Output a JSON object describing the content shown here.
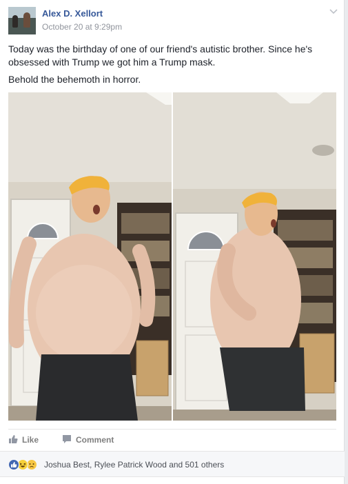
{
  "post": {
    "author": "Alex D. Xellort",
    "timestamp": "October 20 at 9:29pm",
    "text_line1": "Today was the birthday of one of our friend's autistic brother. Since he's obsessed with Trump we got him a Trump mask.",
    "text_line2": "Behold the behemoth in horror.",
    "photos": [
      {
        "name": "photo-left"
      },
      {
        "name": "photo-right"
      }
    ]
  },
  "actions": {
    "like_label": "Like",
    "comment_label": "Comment"
  },
  "reactions": {
    "icons": [
      "like-reaction-icon",
      "haha-reaction-icon",
      "sad-reaction-icon"
    ],
    "summary": "Joshua Best, Rylee Patrick Wood and 501 others"
  },
  "colors": {
    "author": "#365899",
    "timestamp": "#90949c",
    "action": "#7f7f7f",
    "like_blue": "#4267b2"
  }
}
